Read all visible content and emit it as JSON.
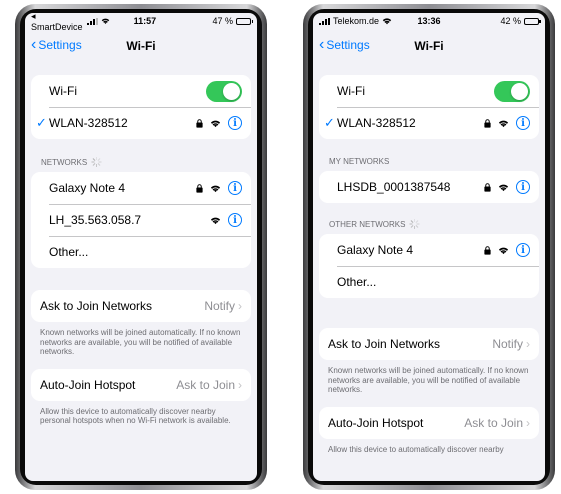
{
  "colors": {
    "accent": "#007aff",
    "toggle_on": "#34c759",
    "background": "#f2f2f7"
  },
  "left": {
    "status": {
      "carrier": "◂ SmartDevice",
      "time": "11:57",
      "battery": "47 %",
      "battery_level": 0.47
    },
    "nav": {
      "back": "Settings",
      "title": "Wi-Fi"
    },
    "wifi_label": "Wi-Fi",
    "connected": "WLAN-328512",
    "networks_header": "NETWORKS",
    "networks": [
      {
        "name": "Galaxy Note 4",
        "locked": true
      },
      {
        "name": "LH_35.563.058.7",
        "locked": false
      }
    ],
    "other": "Other...",
    "ask_join": {
      "label": "Ask to Join Networks",
      "value": "Notify"
    },
    "ask_join_note": "Known networks will be joined automatically. If no known networks are available, you will be notified of available networks.",
    "auto_join": {
      "label": "Auto-Join Hotspot",
      "value": "Ask to Join"
    },
    "auto_join_note": "Allow this device to automatically discover nearby personal hotspots when no Wi-Fi network is available."
  },
  "right": {
    "status": {
      "carrier": "Telekom.de",
      "time": "13:36",
      "battery": "42 %",
      "battery_level": 0.42
    },
    "nav": {
      "back": "Settings",
      "title": "Wi-Fi"
    },
    "wifi_label": "Wi-Fi",
    "connected": "WLAN-328512",
    "my_networks_header": "MY NETWORKS",
    "my_networks": [
      {
        "name": "LHSDB_0001387548",
        "locked": true
      }
    ],
    "other_networks_header": "OTHER NETWORKS",
    "other_networks": [
      {
        "name": "Galaxy Note 4",
        "locked": true
      }
    ],
    "other": "Other...",
    "ask_join": {
      "label": "Ask to Join Networks",
      "value": "Notify"
    },
    "ask_join_note": "Known networks will be joined automatically. If no known networks are available, you will be notified of available networks.",
    "auto_join": {
      "label": "Auto-Join Hotspot",
      "value": "Ask to Join"
    },
    "auto_join_note": "Allow this device to automatically discover nearby"
  }
}
